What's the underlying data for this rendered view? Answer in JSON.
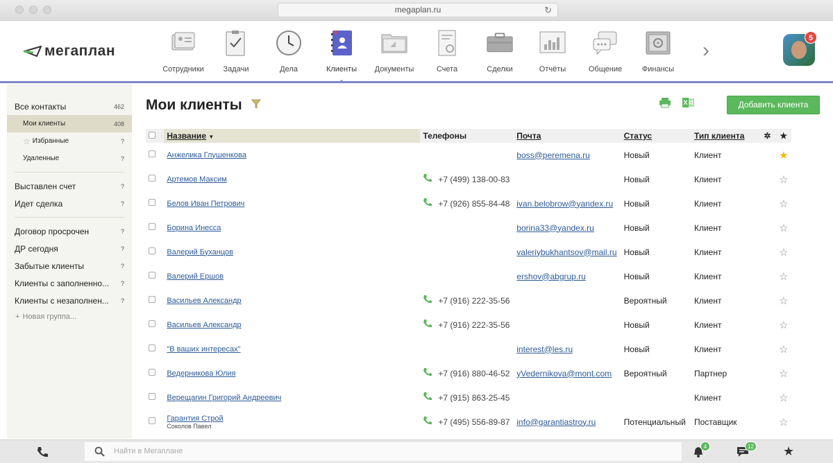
{
  "browser": {
    "url": "megaplan.ru"
  },
  "app": {
    "logo_text": "мегаплан"
  },
  "nav": {
    "items": [
      {
        "label": "Сотрудники",
        "icon": "employees-icon"
      },
      {
        "label": "Задачи",
        "icon": "tasks-icon"
      },
      {
        "label": "Дела",
        "icon": "clock-icon"
      },
      {
        "label": "Клиенты",
        "icon": "clients-icon",
        "active": true
      },
      {
        "label": "Документы",
        "icon": "documents-icon"
      },
      {
        "label": "Счета",
        "icon": "invoices-icon"
      },
      {
        "label": "Сделки",
        "icon": "briefcase-icon"
      },
      {
        "label": "Отчёты",
        "icon": "reports-icon"
      },
      {
        "label": "Общение",
        "icon": "chat-icon"
      },
      {
        "label": "Финансы",
        "icon": "safe-icon"
      }
    ],
    "notifications": "5"
  },
  "sidebar": {
    "items": [
      {
        "label": "Все контакты",
        "count": "462"
      },
      {
        "label": "Мои клиенты",
        "count": "408"
      },
      {
        "label": "Избранные",
        "count": "?"
      },
      {
        "label": "Удаленные",
        "count": "?"
      },
      {
        "label": "Выставлен счет",
        "count": "?"
      },
      {
        "label": "Идет сделка",
        "count": "?"
      },
      {
        "label": "Договор просрочен",
        "count": "?"
      },
      {
        "label": "ДР сегодня",
        "count": "?"
      },
      {
        "label": "Забытые клиенты",
        "count": "?"
      },
      {
        "label": "Клиенты с заполненно...",
        "count": "?"
      },
      {
        "label": "Клиенты с незаполнен...",
        "count": "?"
      }
    ],
    "new_group": "Новая группа..."
  },
  "main": {
    "title": "Мои клиенты",
    "add_button": "Добавить клиента",
    "columns": {
      "name": "Название",
      "phones": "Телефоны",
      "email": "Почта",
      "status": "Статус",
      "type": "Тип клиента"
    },
    "rows": [
      {
        "name": "Анжелика Глушенкова",
        "phone": "",
        "email": "boss@peremena.ru",
        "status": "Новый",
        "type": "Клиент",
        "fav": true
      },
      {
        "name": "Артемов Максим",
        "phone": "+7 (499) 138-00-83",
        "email": "",
        "status": "Новый",
        "type": "Клиент"
      },
      {
        "name": "Белов Иван Петрович",
        "phone": "+7 (926) 855-84-48",
        "email": "ivan.belobrow@yandex.ru",
        "status": "Новый",
        "type": "Клиент"
      },
      {
        "name": "Борина Инесса",
        "phone": "",
        "email": "borina33@yandex.ru",
        "status": "Новый",
        "type": "Клиент"
      },
      {
        "name": "Валерий Буханцов",
        "phone": "",
        "email": "valeriybukhantsov@mail.ru",
        "status": "Новый",
        "type": "Клиент"
      },
      {
        "name": "Валерий Ершов",
        "phone": "",
        "email": "ershov@abgrup.ru",
        "status": "Новый",
        "type": "Клиент"
      },
      {
        "name": "Васильев Александр",
        "phone": "+7 (916) 222-35-56",
        "email": "",
        "status": "Вероятный",
        "type": "Клиент"
      },
      {
        "name": "Васильев Александр",
        "phone": "+7 (916) 222-35-56",
        "email": "",
        "status": "Новый",
        "type": "Клиент"
      },
      {
        "name": "\"В ваших интересах\"",
        "phone": "",
        "email": "interest@les.ru",
        "status": "Новый",
        "type": "Клиент"
      },
      {
        "name": "Ведерникова Юлия",
        "phone": "+7 (916) 880-46-52",
        "email": "yVedernikova@mont.com",
        "status": "Вероятный",
        "type": "Партнер"
      },
      {
        "name": "Верещагин Григорий Андреевич",
        "phone": "+7 (915) 863-25-45",
        "email": "",
        "status": "",
        "type": "Клиент"
      },
      {
        "name": "Гарантия Строй",
        "subname": "Соколов Павел",
        "phone": "+7 (495) 556-89-87",
        "email": "info@garantiastroy.ru",
        "status": "Потенциальный",
        "type": "Поставщик"
      }
    ]
  },
  "bottom": {
    "search_placeholder": "Найти в Мегаплане",
    "bell_count": "4",
    "chat_count": "12"
  }
}
